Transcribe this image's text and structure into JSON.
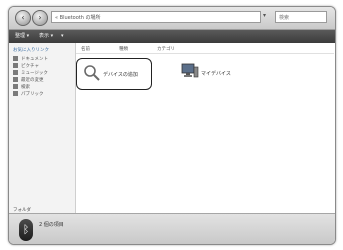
{
  "window": {
    "address_text": "« Bluetooth の場所",
    "search_placeholder": "検索"
  },
  "toolbar": {
    "items": [
      "整理 ▾",
      "表示 ▾",
      "▾"
    ]
  },
  "sidebar": {
    "header": "お気に入りリンク",
    "items": [
      "ドキュメント",
      "ピクチャ",
      "ミュージック",
      "最近の変更",
      "検索",
      "パブリック"
    ],
    "folders_label": "フォルダ"
  },
  "columns": [
    "名前",
    "種類",
    "カテゴリ"
  ],
  "content": {
    "items": [
      {
        "label": "デバイスの追加",
        "icon": "magnifier-icon"
      },
      {
        "label": "マイデバイス",
        "icon": "computer-icon"
      }
    ]
  },
  "status": {
    "text": "2 個の項目"
  },
  "colors": {
    "toolbar": "#4a4a4a",
    "sidebar": "#f3f3f3",
    "highlight_border": "#222222"
  }
}
